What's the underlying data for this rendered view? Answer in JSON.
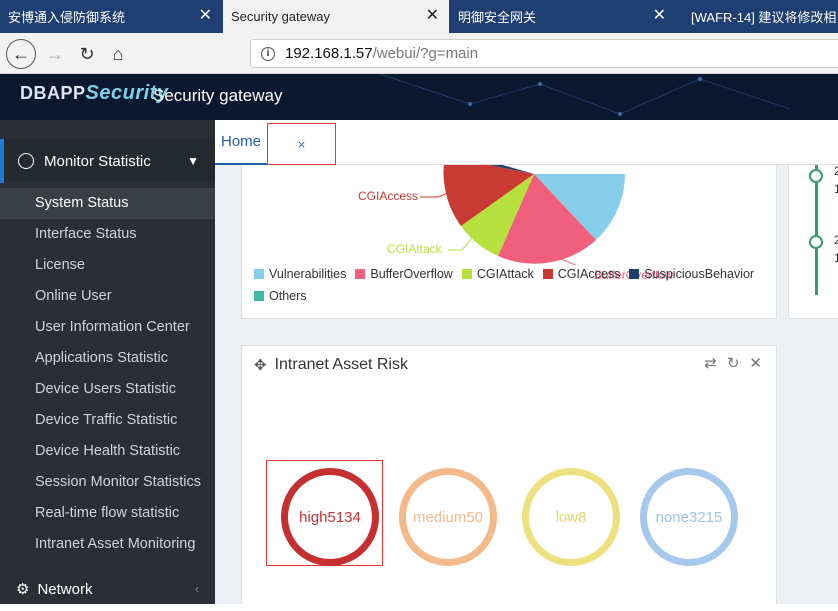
{
  "browser": {
    "tabs": [
      {
        "label": "安博通入侵防御系统",
        "active": false
      },
      {
        "label": "Security gateway",
        "active": true
      },
      {
        "label": "明御安全网关",
        "active": false
      },
      {
        "label": "[WAFR-14] 建议将修改相",
        "active": false
      }
    ],
    "url_host": "192.168.1.57",
    "url_path": "/webui/?g=main"
  },
  "header": {
    "logo_text": "DBAPP",
    "logo_accent": "Security",
    "title": "Security gateway"
  },
  "sidebar": {
    "section_monitor": "Monitor Statistic",
    "items": [
      "System Status",
      "Interface Status",
      "License",
      "Online User",
      "User Information Center",
      "Applications Statistic",
      "Device Users Statistic",
      "Device Traffic Statistic",
      "Device Health Statistic",
      "Session Monitor Statistics",
      "Real-time flow statistic",
      "Intranet Asset Monitoring"
    ],
    "section_network": "Network"
  },
  "content_tabs": {
    "home": "Home",
    "close": "×"
  },
  "attack_chart": {
    "labels": {
      "cgi_access": "CGIAccess",
      "cgi_attack": "CGIAttack",
      "buffer_overflow": "BufferOverflow"
    },
    "legend": [
      {
        "name": "Vulnerabilities",
        "color": "#87ceeb"
      },
      {
        "name": "BufferOverflow",
        "color": "#f0607c"
      },
      {
        "name": "CGIAttack",
        "color": "#b5e03d"
      },
      {
        "name": "CGIAccess",
        "color": "#c83a32"
      },
      {
        "name": "SuspiciousBehavior",
        "color": "#1f3f6a"
      },
      {
        "name": "Others",
        "color": "#3fb8aa"
      }
    ]
  },
  "timeline": {
    "entries": [
      {
        "line1": "2",
        "line2": "1"
      },
      {
        "line1": "2",
        "line2": "1"
      }
    ]
  },
  "risk_panel": {
    "title": "Intranet Asset Risk",
    "levels": [
      {
        "label": "high5134",
        "color": "#c62f2f"
      },
      {
        "label": "medium50",
        "color": "#f4b98a"
      },
      {
        "label": "low8",
        "color": "#e6d76a"
      },
      {
        "label": "none3215",
        "color": "#9ec2ea"
      }
    ]
  }
}
